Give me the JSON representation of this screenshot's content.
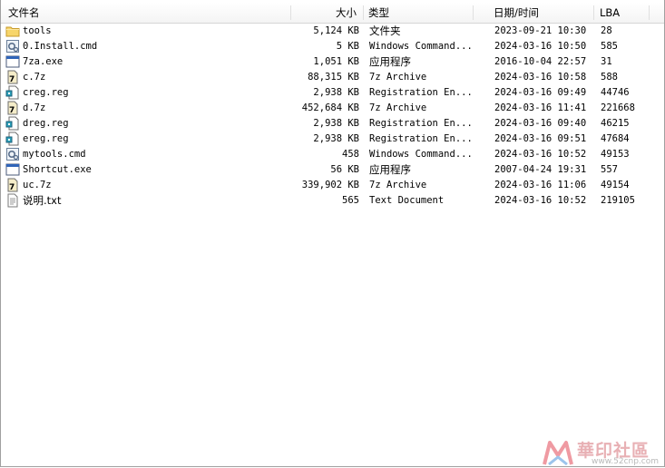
{
  "header": {
    "name": "文件名",
    "size": "大小",
    "type": "类型",
    "date": "日期/时间",
    "lba": "LBA"
  },
  "files": [
    {
      "name": "tools",
      "icon": "folder-icon",
      "size": "5,124 KB",
      "type": "文件夹",
      "date": "2023-09-21 10:30",
      "lba": "28"
    },
    {
      "name": "0.Install.cmd",
      "icon": "cmd-script-icon",
      "size": "5 KB",
      "type": "Windows Command...",
      "date": "2024-03-16 10:50",
      "lba": "585"
    },
    {
      "name": "7za.exe",
      "icon": "exe-icon",
      "size": "1,051 KB",
      "type": "应用程序",
      "date": "2016-10-04 22:57",
      "lba": "31"
    },
    {
      "name": "c.7z",
      "icon": "7z-archive-icon",
      "size": "88,315 KB",
      "type": "7z Archive",
      "date": "2024-03-16 10:58",
      "lba": "588"
    },
    {
      "name": "creg.reg",
      "icon": "reg-file-icon",
      "size": "2,938 KB",
      "type": "Registration En...",
      "date": "2024-03-16 09:49",
      "lba": "44746"
    },
    {
      "name": "d.7z",
      "icon": "7z-archive-icon",
      "size": "452,684 KB",
      "type": "7z Archive",
      "date": "2024-03-16 11:41",
      "lba": "221668"
    },
    {
      "name": "dreg.reg",
      "icon": "reg-file-icon",
      "size": "2,938 KB",
      "type": "Registration En...",
      "date": "2024-03-16 09:40",
      "lba": "46215"
    },
    {
      "name": "ereg.reg",
      "icon": "reg-file-icon",
      "size": "2,938 KB",
      "type": "Registration En...",
      "date": "2024-03-16 09:51",
      "lba": "47684"
    },
    {
      "name": "mytools.cmd",
      "icon": "cmd-script-icon",
      "size": "458",
      "type": "Windows Command...",
      "date": "2024-03-16 10:52",
      "lba": "49153"
    },
    {
      "name": "Shortcut.exe",
      "icon": "exe-icon",
      "size": "56 KB",
      "type": "应用程序",
      "date": "2007-04-24 19:31",
      "lba": "557"
    },
    {
      "name": "uc.7z",
      "icon": "7z-archive-icon",
      "size": "339,902 KB",
      "type": "7z Archive",
      "date": "2024-03-16 11:06",
      "lba": "49154"
    },
    {
      "name": "说明.txt",
      "icon": "text-file-icon",
      "size": "565",
      "type": "Text Document",
      "date": "2024-03-16 10:52",
      "lba": "219105"
    }
  ],
  "watermark": {
    "text": "華印社區",
    "url": "www.52cnp.com"
  }
}
